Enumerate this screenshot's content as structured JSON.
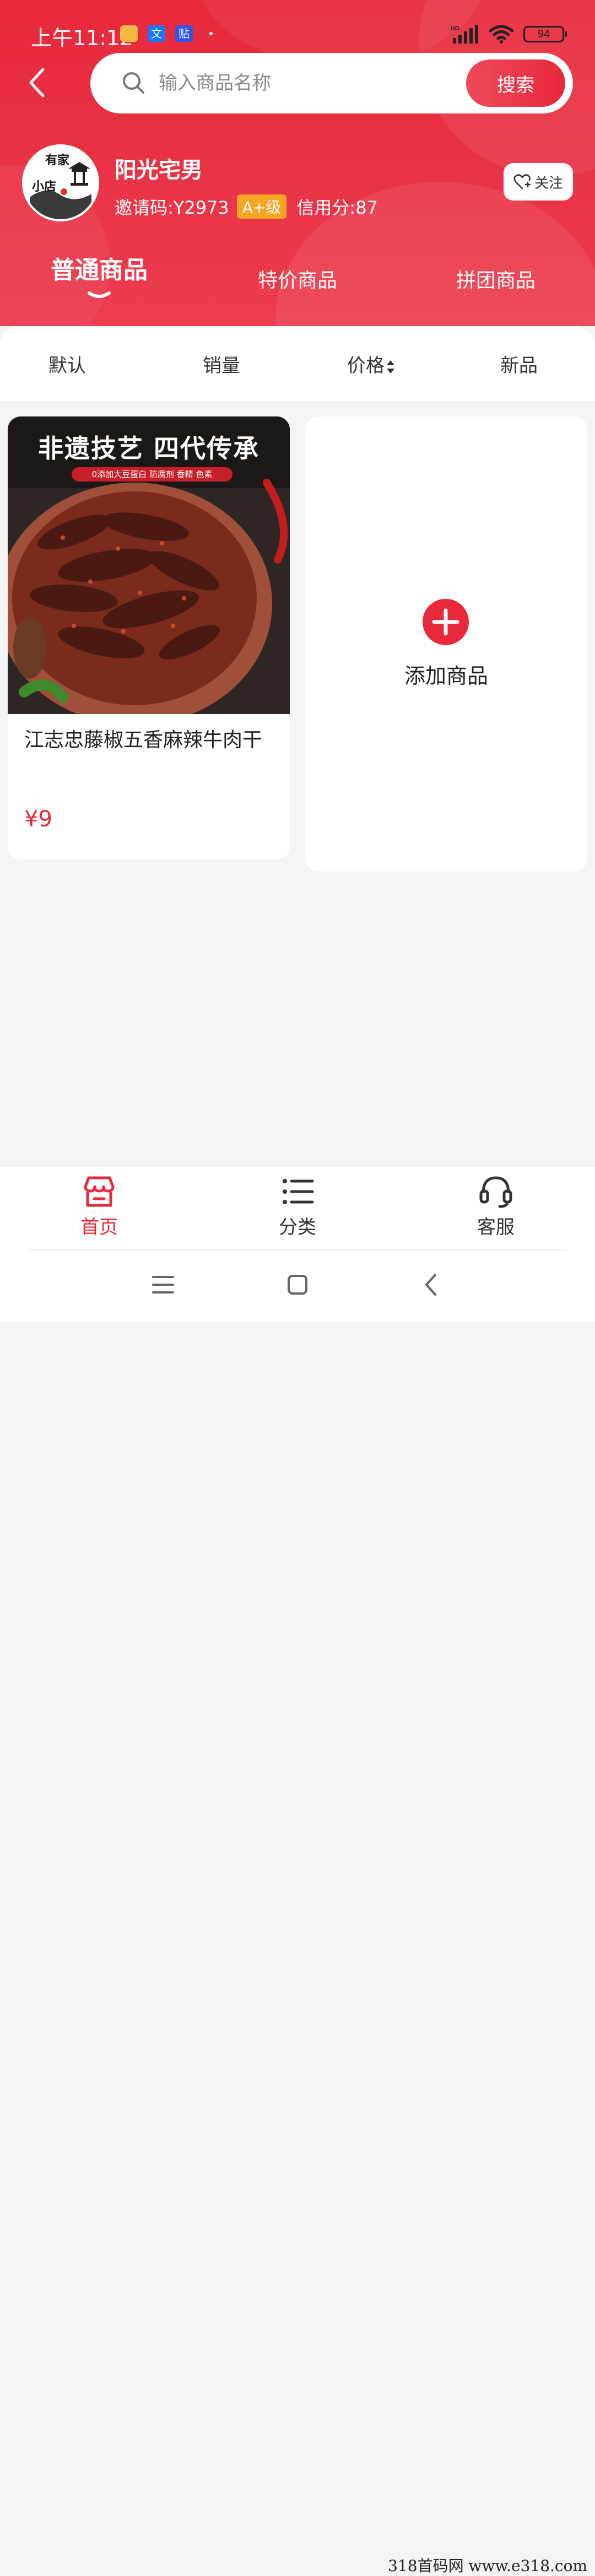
{
  "status_bar": {
    "time": "上午11:12",
    "app_icons": [
      "files-app-icon",
      "translate-app-icon",
      "sticker-app-icon"
    ],
    "battery": "94"
  },
  "search": {
    "placeholder": "输入商品名称",
    "button_label": "搜索"
  },
  "shop": {
    "name": "阳光宅男",
    "invite_code": "邀请码:Y2973",
    "grade": "A+级",
    "credit": "信用分:87",
    "follow_label": "关注",
    "avatar_text": [
      "有家",
      "小店"
    ]
  },
  "category_tabs": [
    {
      "label": "普通商品",
      "active": true
    },
    {
      "label": "特价商品",
      "active": false
    },
    {
      "label": "拼团商品",
      "active": false
    }
  ],
  "sort_options": [
    {
      "label": "默认"
    },
    {
      "label": "销量"
    },
    {
      "label": "价格"
    },
    {
      "label": "新品"
    }
  ],
  "products": [
    {
      "name": "江志忠藤椒五香麻辣牛肉干",
      "price": "¥9",
      "image_title": "非遗技艺 四代传承",
      "image_subtitle": "0添加大豆蛋白 防腐剂 香精 色素"
    }
  ],
  "add_product": {
    "label": "添加商品"
  },
  "bottom_nav": [
    {
      "label": "首页",
      "icon": "shop-icon",
      "active": true
    },
    {
      "label": "分类",
      "icon": "list-icon",
      "active": false
    },
    {
      "label": "客服",
      "icon": "headset-icon",
      "active": false
    }
  ],
  "watermark": "318首码网 www.e318.com",
  "colors": {
    "accent": "#e8283b",
    "grade_badge": "#f6a623",
    "background": "#f4f4f4"
  }
}
